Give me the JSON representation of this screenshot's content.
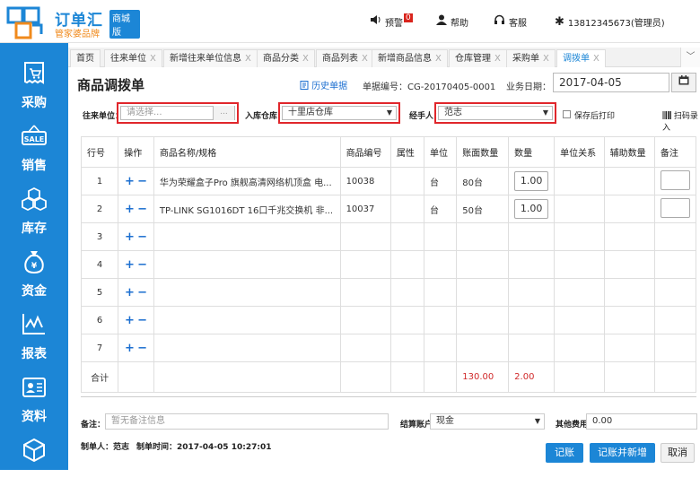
{
  "brand": {
    "title": "订单汇",
    "tag": "商城版",
    "subtitle": "管家婆品牌"
  },
  "topnav": {
    "alert_label": "预警",
    "alert_count": "0",
    "help_label": "帮助",
    "service_label": "客服",
    "user_label": "13812345673(管理员)"
  },
  "sidebar": {
    "items": [
      {
        "label": "采购",
        "icon": "cart-icon"
      },
      {
        "label": "销售",
        "icon": "sale-icon"
      },
      {
        "label": "库存",
        "icon": "boxes-icon"
      },
      {
        "label": "资金",
        "icon": "money-bag-icon"
      },
      {
        "label": "报表",
        "icon": "chart-icon"
      },
      {
        "label": "资料",
        "icon": "id-card-icon"
      },
      {
        "label": "",
        "icon": "cube-icon"
      }
    ]
  },
  "tabs": [
    {
      "label": "首页",
      "closable": false
    },
    {
      "label": "往来单位",
      "closable": true
    },
    {
      "label": "新增往来单位信息",
      "closable": true
    },
    {
      "label": "商品分类",
      "closable": true
    },
    {
      "label": "商品列表",
      "closable": true
    },
    {
      "label": "新增商品信息",
      "closable": true
    },
    {
      "label": "仓库管理",
      "closable": true
    },
    {
      "label": "采购单",
      "closable": true
    },
    {
      "label": "调拨单",
      "closable": true,
      "active": true
    }
  ],
  "tab_close_glyph": "X",
  "tab_more_glyph": "﹀",
  "header": {
    "title": "商品调拨单",
    "history_label": "历史单据",
    "doc_number_label": "单据编号：CG-20170405-0001",
    "date_label": "业务日期：",
    "date_value": "2017-04-05"
  },
  "filters": {
    "partner_label": "往来单位：",
    "partner_placeholder": "请选择...",
    "partner_button": "...",
    "warehouse_label": "入库仓库：",
    "warehouse_value": "十里店仓库",
    "handler_label": "经手人：",
    "handler_value": "范志",
    "print_after_save_label": "保存后打印",
    "scan_label": "扫码录入"
  },
  "table": {
    "columns": [
      "行号",
      "操作",
      "商品名称/规格",
      "商品编号",
      "属性",
      "单位",
      "账面数量",
      "数量",
      "单位关系",
      "辅助数量",
      "备注"
    ],
    "rows": [
      {
        "no": "1",
        "name": "华为荣耀盒子Pro 旗舰高清网络机顶盒 电...",
        "code": "10038",
        "attr": "",
        "unit": "台",
        "book_qty": "80台",
        "qty": "1.00",
        "relation": "",
        "aux_qty": ""
      },
      {
        "no": "2",
        "name": "TP-LINK SG1016DT 16口千兆交换机 非...",
        "code": "10037",
        "attr": "",
        "unit": "台",
        "book_qty": "50台",
        "qty": "1.00",
        "relation": "",
        "aux_qty": ""
      },
      {
        "no": "3"
      },
      {
        "no": "4"
      },
      {
        "no": "5"
      },
      {
        "no": "6"
      },
      {
        "no": "7"
      }
    ],
    "total_label": "合计",
    "total_book_qty": "130.00",
    "total_qty": "2.00",
    "op_add": "+",
    "op_remove": "−"
  },
  "footer": {
    "remark_label": "备注：",
    "remark_placeholder": "暂无备注信息",
    "account_label": "结算账户：",
    "account_value": "现金",
    "other_fee_label": "其他费用：",
    "other_fee_value": "0.00",
    "creator_label": "制单人：范志",
    "created_time_label": "制单时间：2017-04-05 10:27:01"
  },
  "buttons": {
    "save": "记账",
    "save_new": "记账并新增",
    "cancel": "取消"
  },
  "colors": {
    "primary": "#1c86d6",
    "highlight": "#e0262b",
    "total": "#d0292a"
  }
}
